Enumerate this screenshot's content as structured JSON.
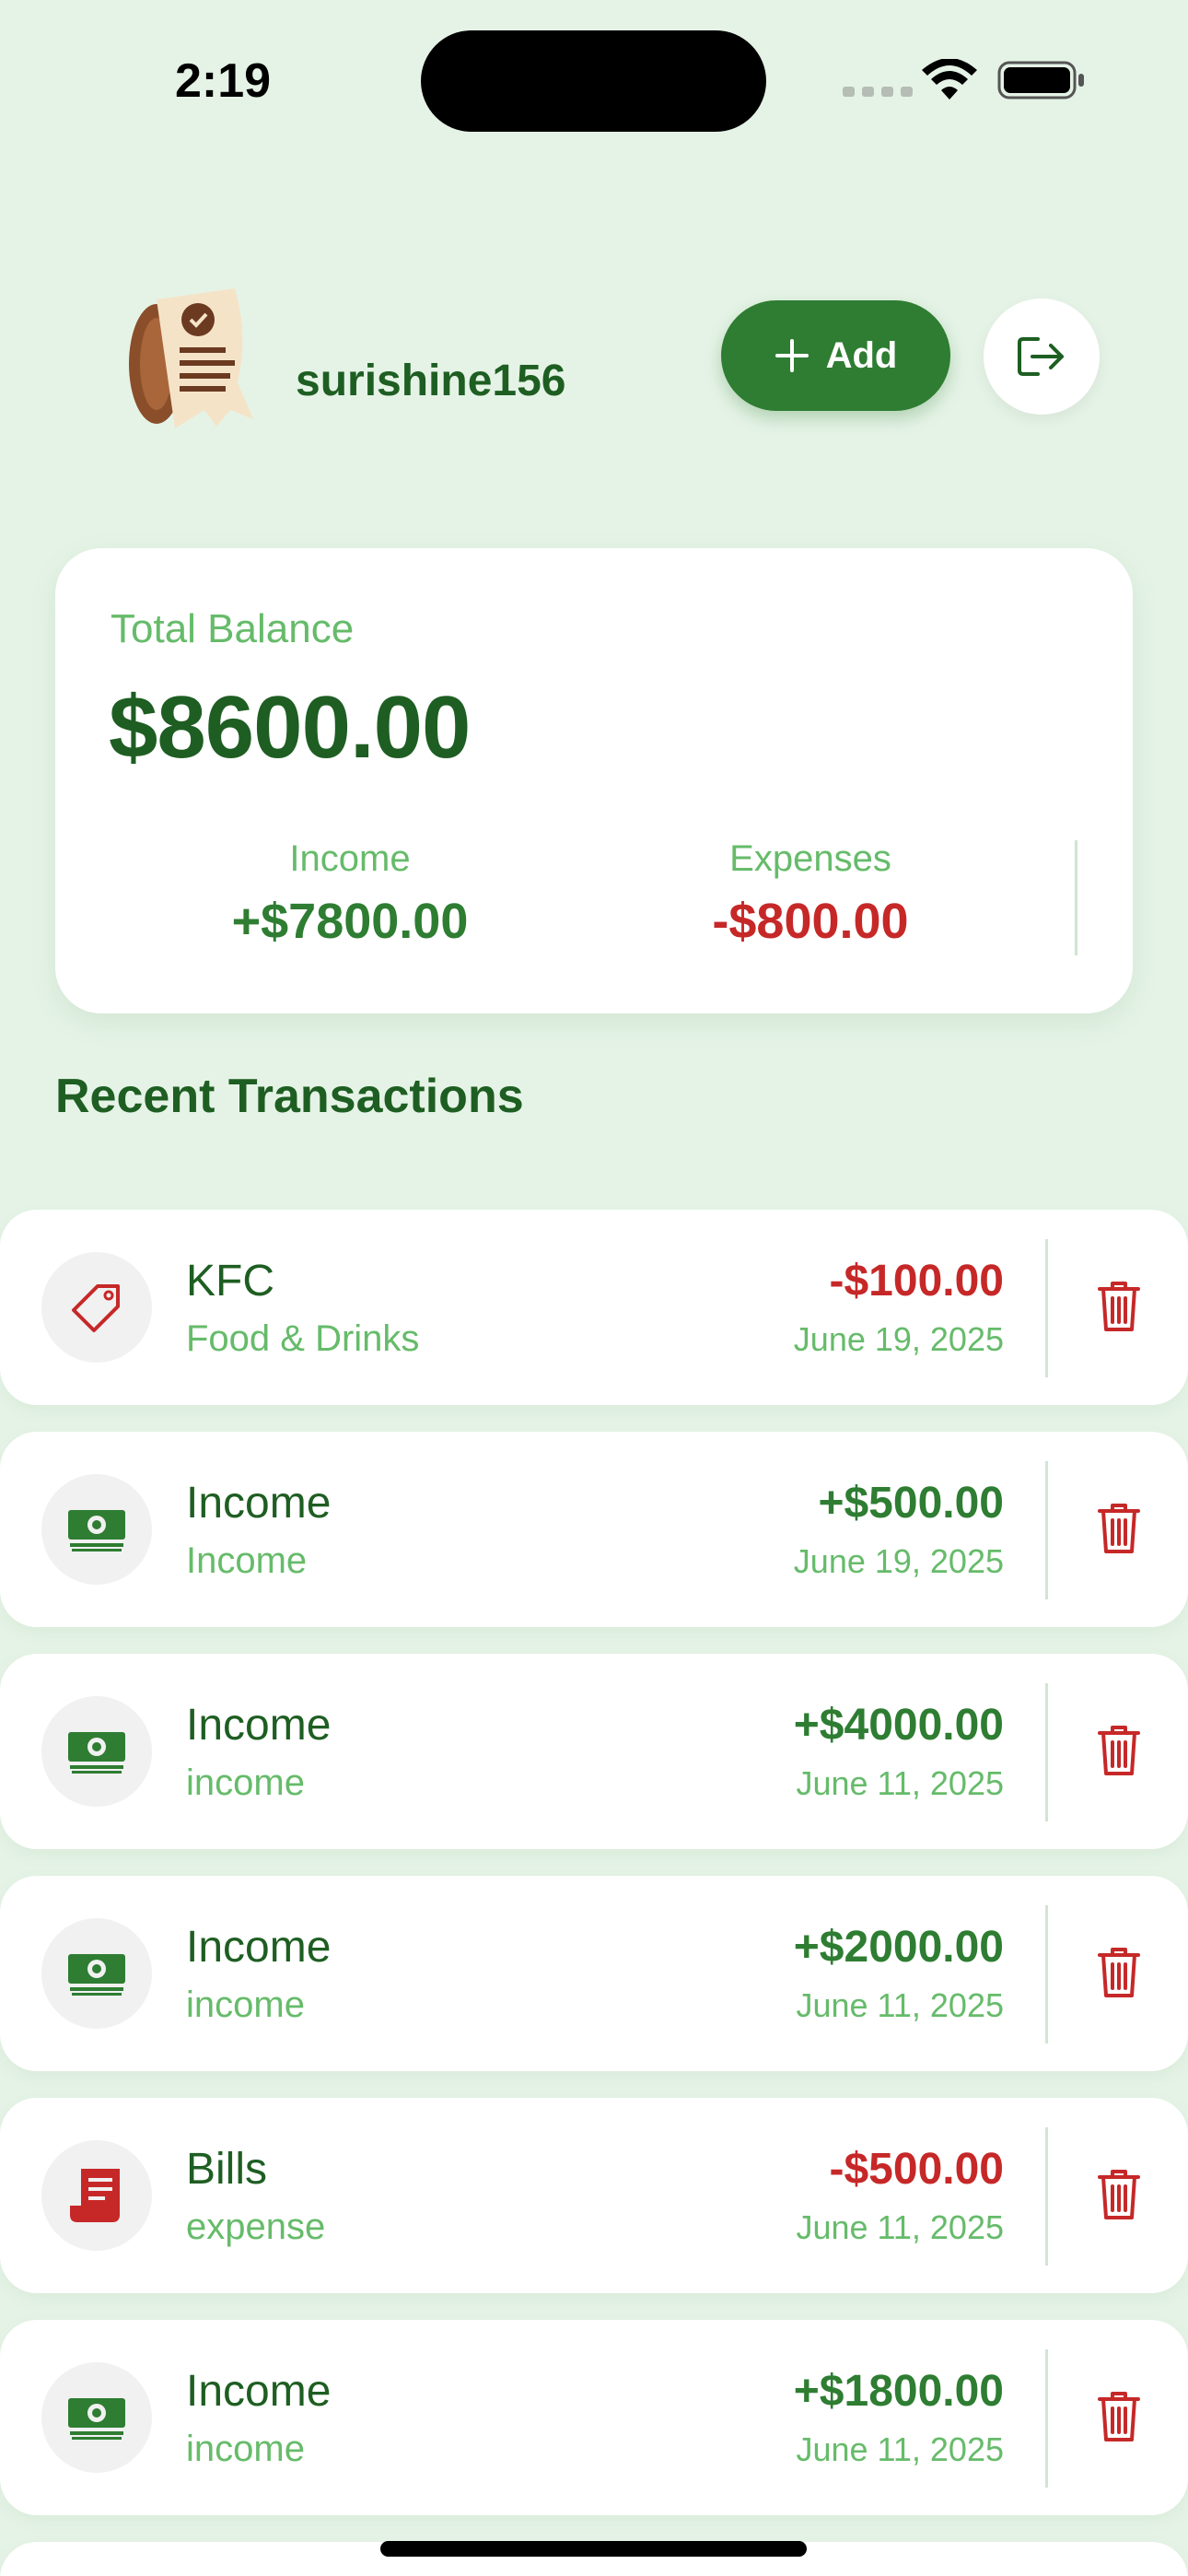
{
  "status_bar": {
    "time": "2:19"
  },
  "header": {
    "username": "surishine156",
    "add_label": "Add",
    "logo_icon": "receipt-logo-icon",
    "logout_icon": "logout-icon"
  },
  "balance": {
    "label": "Total Balance",
    "amount": "$8600.00",
    "income_label": "Income",
    "income_value": "+$7800.00",
    "expenses_label": "Expenses",
    "expenses_value": "-$800.00"
  },
  "section_title": "Recent Transactions",
  "colors": {
    "background": "#e5f3e6",
    "primary_green": "#2e7d32",
    "dark_green": "#1e5e22",
    "light_green": "#66bb6a",
    "red": "#c62828"
  },
  "transactions": [
    {
      "title": "KFC",
      "subtitle": "Food & Drinks",
      "amount": "-$100.00",
      "date": "June 19, 2025",
      "kind": "neg",
      "icon": "tag-icon"
    },
    {
      "title": "Income",
      "subtitle": "Income",
      "amount": "+$500.00",
      "date": "June 19, 2025",
      "kind": "pos",
      "icon": "cash-icon"
    },
    {
      "title": "Income",
      "subtitle": "income",
      "amount": "+$4000.00",
      "date": "June 11, 2025",
      "kind": "pos",
      "icon": "cash-icon"
    },
    {
      "title": "Income",
      "subtitle": "income",
      "amount": "+$2000.00",
      "date": "June 11, 2025",
      "kind": "pos",
      "icon": "cash-icon"
    },
    {
      "title": "Bills",
      "subtitle": "expense",
      "amount": "-$500.00",
      "date": "June 11, 2025",
      "kind": "neg",
      "icon": "bill-receipt-icon"
    },
    {
      "title": "Income",
      "subtitle": "income",
      "amount": "+$1800.00",
      "date": "June 11, 2025",
      "kind": "pos",
      "icon": "cash-icon"
    }
  ]
}
